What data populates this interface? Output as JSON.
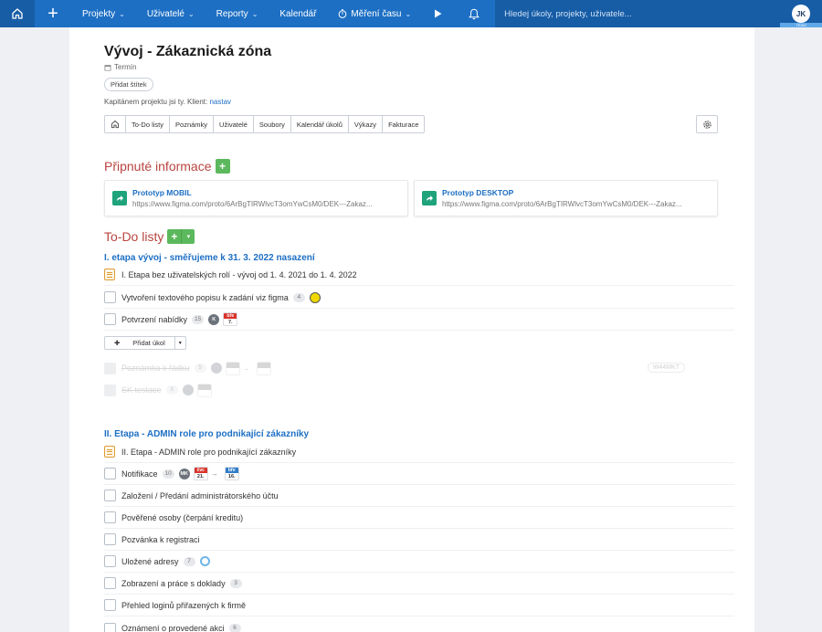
{
  "topbar": {
    "nav": [
      {
        "label": "Projekty",
        "has_menu": true
      },
      {
        "label": "Uživatelé",
        "has_menu": true
      },
      {
        "label": "Reporty",
        "has_menu": true
      },
      {
        "label": "Kalendář",
        "has_menu": false
      },
      {
        "label": "Měření času",
        "has_menu": true
      }
    ],
    "search_placeholder": "Hledej úkoly, projekty, uživatele...",
    "avatar_initials": "JK",
    "avatar_tag": "TEAM",
    "color": "#1d6fc4"
  },
  "project": {
    "title": "Vývoj - Zákaznická zóna",
    "termin": "Termín",
    "add_tag": "Přidat štítek",
    "captain_text": "Kapitánem projektu jsi ty. Klient:",
    "client": "nastav"
  },
  "tabs": [
    "To-Do listy",
    "Poznámky",
    "Uživatelé",
    "Soubory",
    "Kalendář úkolů",
    "Výkazy",
    "Fakturace"
  ],
  "pinned": {
    "heading": "Připnuté informace",
    "items": [
      {
        "title": "Prototyp MOBIL",
        "url": "https://www.figma.com/proto/6ArBgTIRWlvcT3omYwCsM0/DEK---Zakaz..."
      },
      {
        "title": "Prototyp DESKTOP",
        "url": "https://www.figma.com/proto/6ArBgTIRWlvcT3omYwCsM0/DEK---Zakaz..."
      }
    ]
  },
  "todo": {
    "heading": "To-Do listy",
    "add_task_label": "Přidat úkol",
    "lists": [
      {
        "title": "I. etapa vývoj - směřujeme k 31. 3. 2022 nasazení",
        "note": "I. Etapa bez uživatelských rolí - vývoj od 1. 4. 2021 do 1. 4. 2022",
        "tasks": [
          {
            "label": "Vytvoření textového popisu k zadání viz figma",
            "count": "4"
          },
          {
            "label": "Potvrzení nabídky",
            "count": "15",
            "user": "K",
            "cal_month": "bře",
            "cal_day": "7."
          }
        ],
        "done": [
          {
            "label": "Poznámka k řádku",
            "count": "5",
            "code": "W44MKT"
          },
          {
            "label": "SK testace",
            "count": "3"
          }
        ]
      },
      {
        "title": "II. Etapa - ADMIN role pro podnikající zákazníky",
        "note": "II. Etapa - ADMIN role pro podnikající zákazníky",
        "tasks": [
          {
            "label": "Notifikace",
            "count": "10",
            "user": "MK",
            "cal_from_month": "čvc",
            "cal_from_day": "21.",
            "cal_to_month": "bře",
            "cal_to_day": "16."
          },
          {
            "label": "Založení / Předání administrátorského účtu"
          },
          {
            "label": "Pověřené osoby (čerpání kreditu)"
          },
          {
            "label": "Pozvánka k registraci"
          },
          {
            "label": "Uložené adresy",
            "count": "7"
          },
          {
            "label": "Zobrazení a práce s doklady",
            "count": "3"
          },
          {
            "label": "Přehled loginů přiřazených k firmě"
          },
          {
            "label": "Oznámení o provedené akci",
            "count": "6"
          }
        ]
      }
    ]
  }
}
